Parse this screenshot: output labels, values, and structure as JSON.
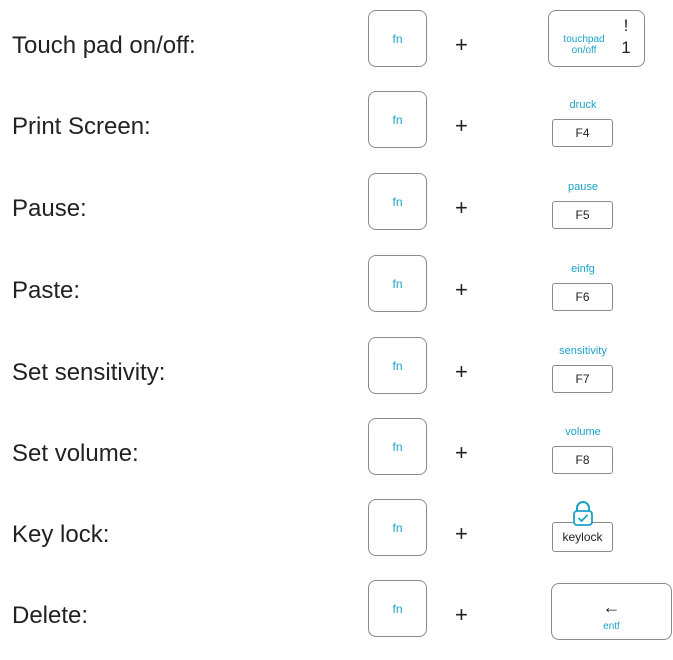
{
  "rows": [
    {
      "label": "Touch pad on/off:",
      "fn": "fn",
      "plus": "+",
      "key_sub": "touchpad on/off",
      "key_top": "!",
      "key_bottom": "1"
    },
    {
      "label": "Print Screen:",
      "fn": "fn",
      "plus": "+",
      "key_sub": "druck",
      "key": "F4"
    },
    {
      "label": "Pause:",
      "fn": "fn",
      "plus": "+",
      "key_sub": "pause",
      "key": "F5"
    },
    {
      "label": "Paste:",
      "fn": "fn",
      "plus": "+",
      "key_sub": "einfg",
      "key": "F6"
    },
    {
      "label": "Set sensitivity:",
      "fn": "fn",
      "plus": "+",
      "key_sub": "sensitivity",
      "key": "F7"
    },
    {
      "label": "Set volume:",
      "fn": "fn",
      "plus": "+",
      "key_sub": "volume",
      "key": "F8"
    },
    {
      "label": "Key lock:",
      "fn": "fn",
      "plus": "+",
      "key": "keylock",
      "icon": "lock-icon"
    },
    {
      "label": "Delete:",
      "fn": "fn",
      "plus": "+",
      "key_sub": "entf",
      "key_symbol": "←"
    }
  ],
  "colors": {
    "accent": "#1aa3c8",
    "text": "#222222",
    "key_border": "#8a8a8a"
  }
}
